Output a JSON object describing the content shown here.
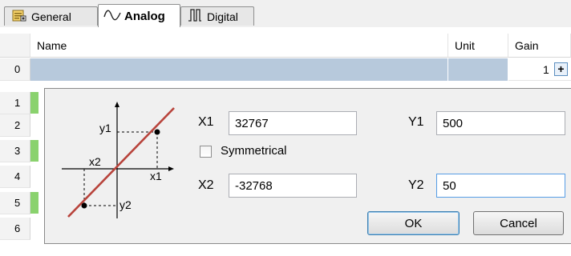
{
  "tabs": [
    {
      "label": "General",
      "icon": "general-tab-icon"
    },
    {
      "label": "Analog",
      "icon": "analog-wave-icon"
    },
    {
      "label": "Digital",
      "icon": "digital-signal-icon"
    }
  ],
  "grid": {
    "headers": {
      "name": "Name",
      "unit": "Unit",
      "gain": "Gain"
    },
    "rows": [
      "0",
      "1",
      "2",
      "3",
      "4",
      "5",
      "6"
    ],
    "gain_value": "1",
    "gain_button": "+"
  },
  "dialog": {
    "diagram_labels": {
      "y1": "y1",
      "x2": "x2",
      "x1": "x1",
      "y2": "y2"
    },
    "x1_label": "X1",
    "x1_value": "32767",
    "y1_label": "Y1",
    "y1_value": "500",
    "symmetrical_label": "Symmetrical",
    "x2_label": "X2",
    "x2_value": "-32768",
    "y2_label": "Y2",
    "y2_value": "50",
    "ok_label": "OK",
    "cancel_label": "Cancel"
  },
  "colors": {
    "row_marker": "#8ad26e",
    "selected_row": "#b7c9dc",
    "diagram_line": "#b8433b",
    "focus_border": "#569de5"
  }
}
